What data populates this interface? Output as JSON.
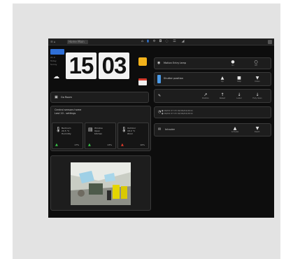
{
  "topbar": {
    "left_label": "☰  ⌂",
    "title": "Home Main",
    "icons": [
      "home-icon",
      "signal-icon",
      "gear-icon",
      "camera-icon",
      "wifi-icon",
      "settings-icon"
    ],
    "close_icon": "close-icon"
  },
  "clock": {
    "hours": "15",
    "minutes": "03",
    "weather_temp": "21.0",
    "weather_day": "Today",
    "weather_sub": "Sunny"
  },
  "left_panels": {
    "status_row_label": "Go Room",
    "sensors_title": "Central sensors home",
    "sensors_sub": "Last 10 - settings",
    "cells": [
      {
        "icon": "thermometer-icon",
        "text": "Bedroom\n20.5 °C\nHumidity",
        "badge": "▲",
        "badge_color": "#39c94a",
        "value": "17%"
      },
      {
        "icon": "window-icon",
        "text": "Window\nOpen\nKitchen",
        "badge": "▲",
        "badge_color": "#39c94a",
        "value": "13%"
      },
      {
        "icon": "thermometer-icon",
        "text": "Outdoor\n18.0 °C\nWind",
        "badge": "▲",
        "badge_color": "#e23a2a",
        "value": "10%"
      }
    ]
  },
  "right_panels": {
    "row1_label": "Motion Entry lamp",
    "row1_actions": [
      {
        "glyph": "●",
        "label": "On"
      },
      {
        "glyph": "○",
        "label": "Off"
      }
    ],
    "row2_label": "Shutter position",
    "row2_actions": [
      {
        "glyph": "▲",
        "label": "Up"
      },
      {
        "glyph": "■",
        "label": "Stop"
      },
      {
        "glyph": "▼",
        "label": "Down"
      }
    ],
    "row3_actions": [
      {
        "glyph": "↗",
        "label": "Position"
      },
      {
        "glyph": "↑",
        "label": "Raised"
      },
      {
        "glyph": "↓",
        "label": "Lower"
      },
      {
        "glyph": "↓",
        "label": "Fully down"
      }
    ],
    "row4_lines": "● 04/04 07:15 02/04/02/2011\n● 04/04 07:15 02/04/02/2011",
    "row5_label": "Intruder",
    "row5_actions": [
      {
        "glyph": "▲",
        "label": "Activate"
      },
      {
        "glyph": "▼",
        "label": "Deact."
      }
    ]
  },
  "colors": {
    "background": "#0d0d0d",
    "panel": "#1d1d1d",
    "accent_blue": "#4b9be8",
    "sun": "#f3b21b",
    "status_green": "#39c94a",
    "status_red": "#e23a2a"
  }
}
